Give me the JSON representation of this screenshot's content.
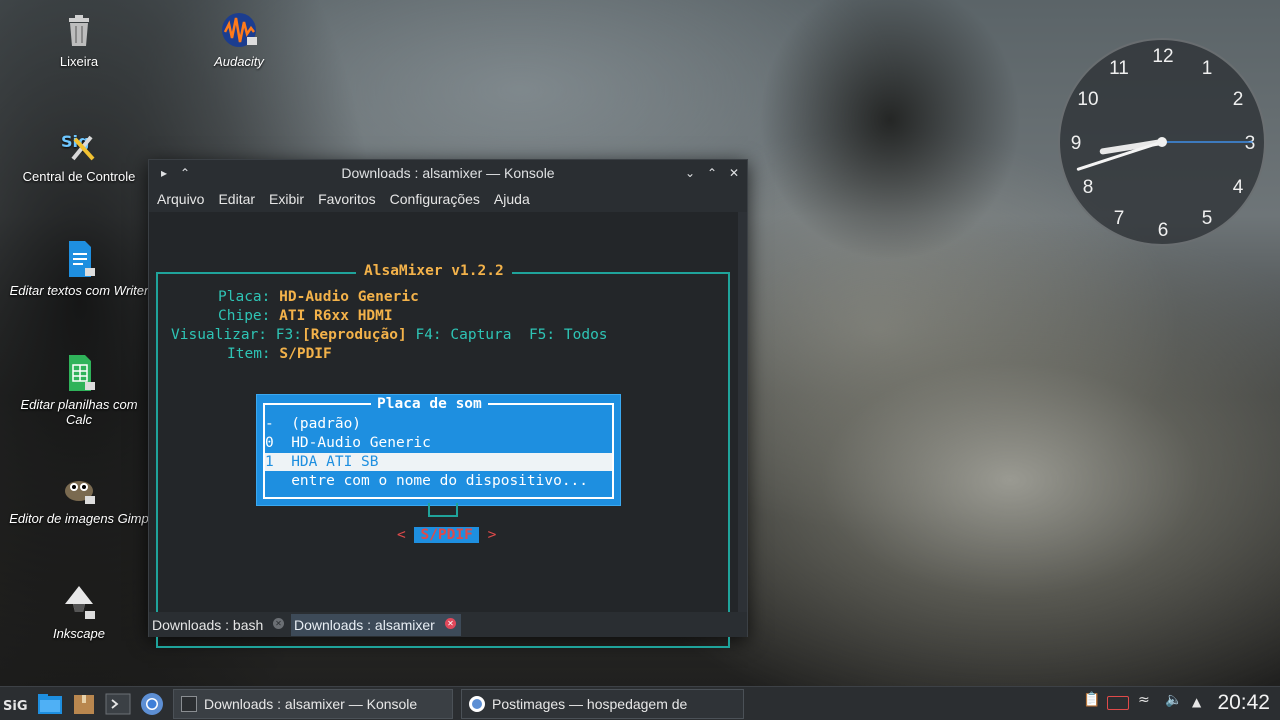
{
  "desktop": {
    "icons": [
      {
        "label": "Lixeira",
        "icon": "trash-icon"
      },
      {
        "label": "Audacity",
        "icon": "audacity-icon"
      },
      {
        "label": "Central de Controle",
        "icon": "control-center-icon"
      },
      {
        "label": "Editar textos com Writer",
        "icon": "writer-icon"
      },
      {
        "label": "Editar planilhas com Calc",
        "icon": "calc-icon"
      },
      {
        "label": "Editor de imagens Gimp",
        "icon": "gimp-icon"
      },
      {
        "label": "Inkscape",
        "icon": "inkscape-icon"
      }
    ]
  },
  "window": {
    "title": "Downloads : alsamixer — Konsole",
    "menu": [
      "Arquivo",
      "Editar",
      "Exibir",
      "Favoritos",
      "Configurações",
      "Ajuda"
    ],
    "tabs": [
      {
        "label": "Downloads : bash",
        "active": false
      },
      {
        "label": "Downloads : alsamixer",
        "active": true
      }
    ]
  },
  "alsamixer": {
    "title": "AlsaMixer v1.2.2",
    "card_label": "Placa:",
    "card_value": "HD-Audio Generic",
    "chip_label": "Chipe:",
    "chip_value": "ATI R6xx HDMI",
    "view_label": "Visualizar:",
    "view_f3": "F3:",
    "view_f3_value": "[Reprodução]",
    "view_rest": "F4: Captura  F5: Todos",
    "item_label": "Item:",
    "item_value": "S/PDIF",
    "control_left_arrow": "<",
    "control_name": "S/PDIF",
    "control_right_arrow": ">",
    "dialog": {
      "title": "Placa de som",
      "items": [
        {
          "key": "-",
          "label": "(padrão)",
          "selected": false
        },
        {
          "key": "0",
          "label": "HD-Audio Generic",
          "selected": false
        },
        {
          "key": "1",
          "label": "HDA ATI SB",
          "selected": true
        },
        {
          "key": " ",
          "label": "entre com o nome do dispositivo...",
          "selected": false
        }
      ]
    }
  },
  "clock": {
    "numbers": [
      "12",
      "1",
      "2",
      "3",
      "4",
      "5",
      "6",
      "7",
      "8",
      "9",
      "10",
      "11"
    ],
    "hour": 20,
    "minute": 42
  },
  "taskbar": {
    "tasks": [
      {
        "label": "Downloads : alsamixer — Konsole",
        "icon": "konsole-icon"
      },
      {
        "label": "Postimages — hospedagem de imagen...",
        "icon": "chrome-icon"
      }
    ],
    "time": "20:42"
  }
}
